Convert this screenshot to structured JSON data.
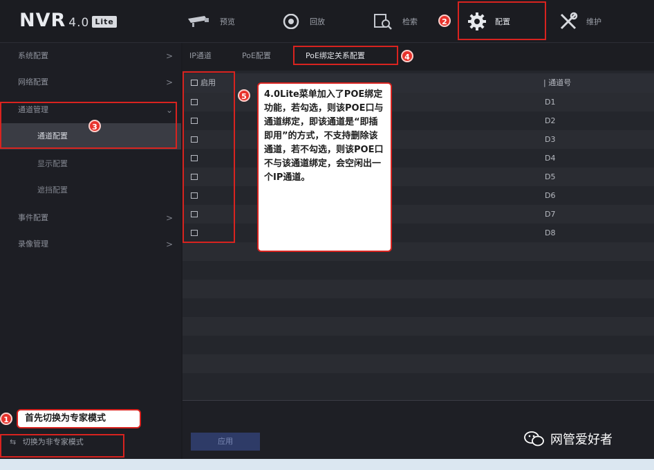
{
  "app": {
    "logo": "NVR",
    "version": "4.0",
    "edition": "Lite"
  },
  "topnav": [
    {
      "label": "预览",
      "icon": "camera-icon"
    },
    {
      "label": "回放",
      "icon": "eye-icon"
    },
    {
      "label": "检索",
      "icon": "search-icon"
    },
    {
      "label": "配置",
      "icon": "gear-icon"
    },
    {
      "label": "维护",
      "icon": "tools-icon"
    }
  ],
  "sidebar": {
    "items": [
      {
        "label": "系统配置",
        "arrow": ">"
      },
      {
        "label": "网络配置",
        "arrow": ">"
      },
      {
        "label": "通道管理",
        "arrow": "⌄"
      },
      {
        "label": "通道配置"
      },
      {
        "label": "显示配置"
      },
      {
        "label": "遮挡配置"
      },
      {
        "label": "事件配置",
        "arrow": ">"
      },
      {
        "label": "录像管理",
        "arrow": ">"
      }
    ],
    "footer": "切换为非专家模式"
  },
  "tabs": [
    {
      "label": "IP通道"
    },
    {
      "label": "PoE配置"
    },
    {
      "label": "PoE绑定关系配置"
    }
  ],
  "table": {
    "col_enable": "启用",
    "col_channel": "通道号",
    "rows": [
      "D1",
      "D2",
      "D3",
      "D4",
      "D5",
      "D6",
      "D7",
      "D8"
    ]
  },
  "buttons": {
    "apply": "应用"
  },
  "annotations": {
    "n1": "1",
    "n2": "2",
    "n3": "3",
    "n4": "4",
    "n5": "5",
    "callout_5": "4.0Lite菜单加入了POE绑定功能，若勾选，则该POE口与通道绑定，即该通道是“即插即用”的方式，不支持删除该通道，若不勾选，则该POE口不与该通道绑定，会空闲出一个IP通道。",
    "callout_1": "首先切换为专家模式",
    "accent": "#d9231f"
  },
  "watermark": "网管爱好者"
}
